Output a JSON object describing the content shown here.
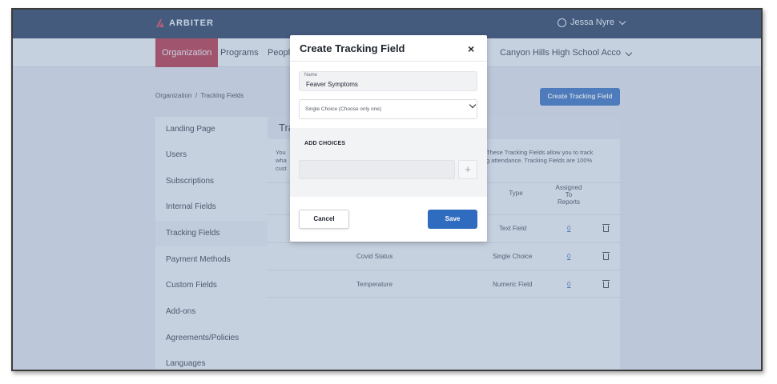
{
  "header": {
    "brand": "ARBITER",
    "user_name": "Jessa Nyre"
  },
  "nav": {
    "items": [
      "Organization",
      "Programs",
      "People"
    ],
    "org_name": "Canyon Hills High School Acco"
  },
  "breadcrumb": {
    "root": "Organization",
    "separator": "/",
    "current": "Tracking Fields"
  },
  "page": {
    "create_button": "Create Tracking Field",
    "title": "Tra",
    "desc_left": [
      "You",
      "wha",
      "cust"
    ],
    "desc_right": [
      "These Tracking Fields allow you to track",
      "g attendance. Tracking Fields are 100%"
    ]
  },
  "sidebar": {
    "items": [
      "Landing Page",
      "Users",
      "Subscriptions",
      "Internal Fields",
      "Tracking Fields",
      "Payment Methods",
      "Custom Fields",
      "Add-ons",
      "Agreements/Policies",
      "Languages"
    ],
    "active_index": 4
  },
  "table": {
    "headers": {
      "type": "Type",
      "assigned": [
        "Assigned",
        "To",
        "Reports"
      ]
    },
    "rows": [
      {
        "name": "",
        "type": "Text Field",
        "assigned": "0"
      },
      {
        "name": "Covid Status",
        "type": "Single Choice",
        "assigned": "0"
      },
      {
        "name": "Temperature",
        "type": "Numeric Field",
        "assigned": "0"
      }
    ]
  },
  "modal": {
    "title": "Create Tracking Field",
    "close": "×",
    "name_label": "Name",
    "name_value": "Feaver Symptoms",
    "select_value": "Single Choice (Choose only one)",
    "choices_title": "ADD CHOICES",
    "add_choice": "+",
    "cancel": "Cancel",
    "save": "Save"
  },
  "colors": {
    "topbar": "#1f3557",
    "active_nav": "#c0283a",
    "primary": "#2f6bbf",
    "overlay": "rgba(120,145,180,0.42)"
  }
}
